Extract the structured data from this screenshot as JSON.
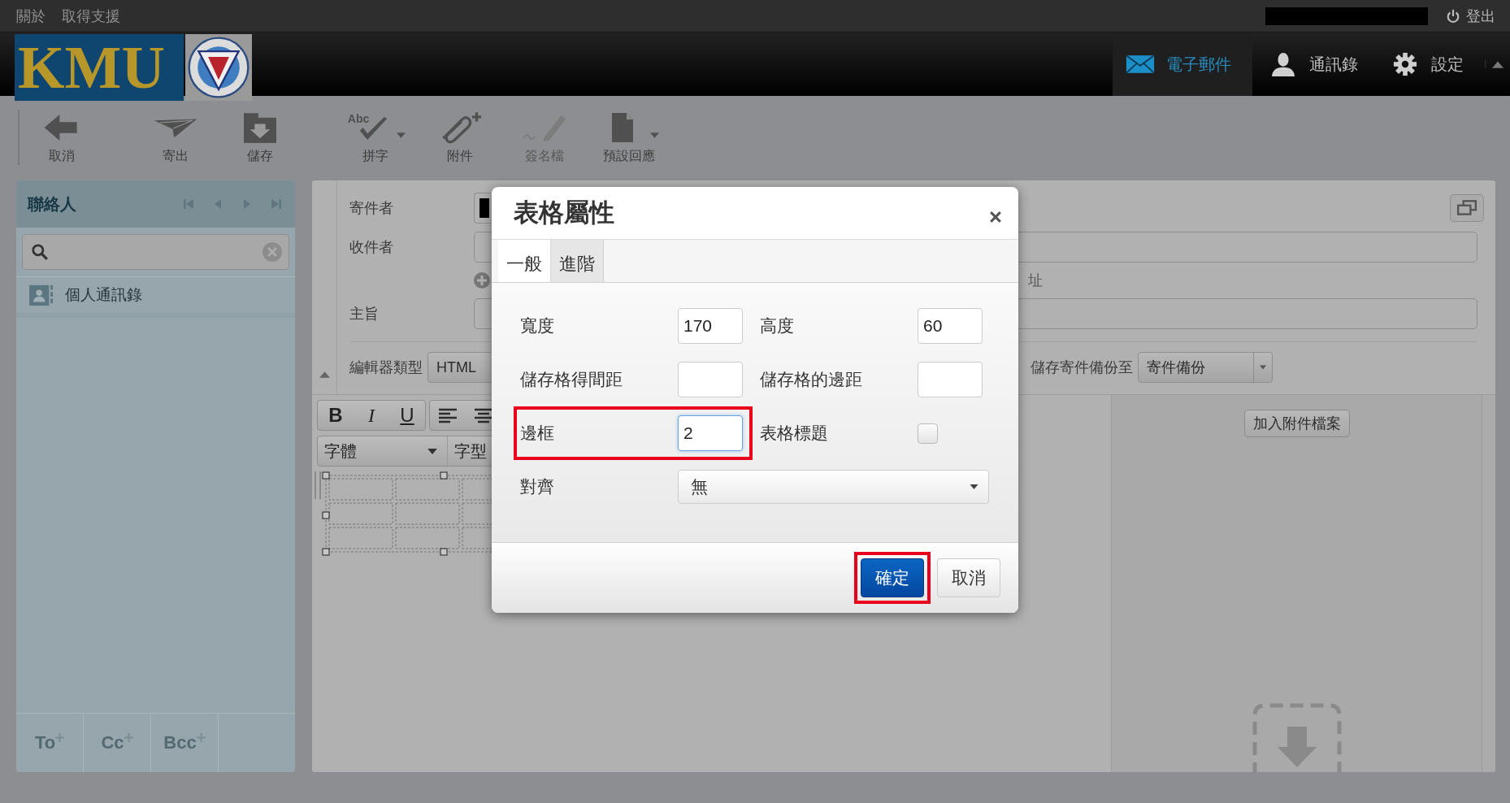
{
  "top_bar": {
    "links": [
      "關於",
      "取得支援"
    ],
    "logout": "登出"
  },
  "header": {
    "logo_text": "KMU",
    "nav": [
      {
        "label": "電子郵件",
        "selected": true
      },
      {
        "label": "通訊錄",
        "selected": false
      },
      {
        "label": "設定",
        "selected": false
      }
    ]
  },
  "toolbar": [
    [
      {
        "label": "取消",
        "disabled": false,
        "dropdown": false
      }
    ],
    [
      {
        "label": "寄出",
        "disabled": false,
        "dropdown": false
      },
      {
        "label": "儲存",
        "disabled": false,
        "dropdown": false
      }
    ],
    [
      {
        "label": "拼字",
        "icon_text": "Abc",
        "disabled": false,
        "dropdown": true
      },
      {
        "label": "附件",
        "disabled": false,
        "dropdown": false
      },
      {
        "label": "簽名檔",
        "disabled": true,
        "dropdown": false
      },
      {
        "label": "預設回應",
        "disabled": false,
        "dropdown": true
      }
    ]
  ],
  "contacts": {
    "title": "聯絡人",
    "items": [
      {
        "label": "個人通訊錄"
      }
    ],
    "recipient_buttons": [
      "To",
      "Cc",
      "Bcc"
    ]
  },
  "compose": {
    "fields": [
      {
        "label": "寄件者"
      },
      {
        "label": "收件者"
      },
      {
        "label": "主旨"
      }
    ],
    "address_hint": "址",
    "editor_type": {
      "label": "編輯器類型",
      "value": "HTML"
    },
    "save_copy": {
      "label": "儲存寄件備份至",
      "value": "寄件備份"
    },
    "format_buttons": [
      "B",
      "I",
      "U"
    ],
    "font_select": "字體",
    "size_select": "字型",
    "attach_button": "加入附件檔案"
  },
  "dialog": {
    "title": "表格屬性",
    "tabs": [
      {
        "label": "一般",
        "selected": true
      },
      {
        "label": "進階",
        "selected": false
      }
    ],
    "fields": [
      {
        "label": "寬度",
        "kind": "text",
        "value": "170",
        "highlighted": false
      },
      {
        "label": "高度",
        "kind": "text",
        "value": "60",
        "highlighted": false
      },
      {
        "label": "儲存格得間距",
        "kind": "text",
        "highlighted": false
      },
      {
        "label": "儲存格的邊距",
        "kind": "text",
        "highlighted": false
      },
      {
        "label": "邊框",
        "kind": "text",
        "value": "2",
        "highlighted": true
      },
      {
        "label": "表格標題",
        "kind": "checkbox",
        "checked": false,
        "highlighted": false
      },
      {
        "label": "對齊",
        "kind": "select",
        "value": "無",
        "highlighted": false
      }
    ],
    "buttons": [
      {
        "label": "確定",
        "kind": "primary",
        "highlighted": true
      },
      {
        "label": "取消",
        "kind": "default",
        "highlighted": false
      }
    ]
  }
}
